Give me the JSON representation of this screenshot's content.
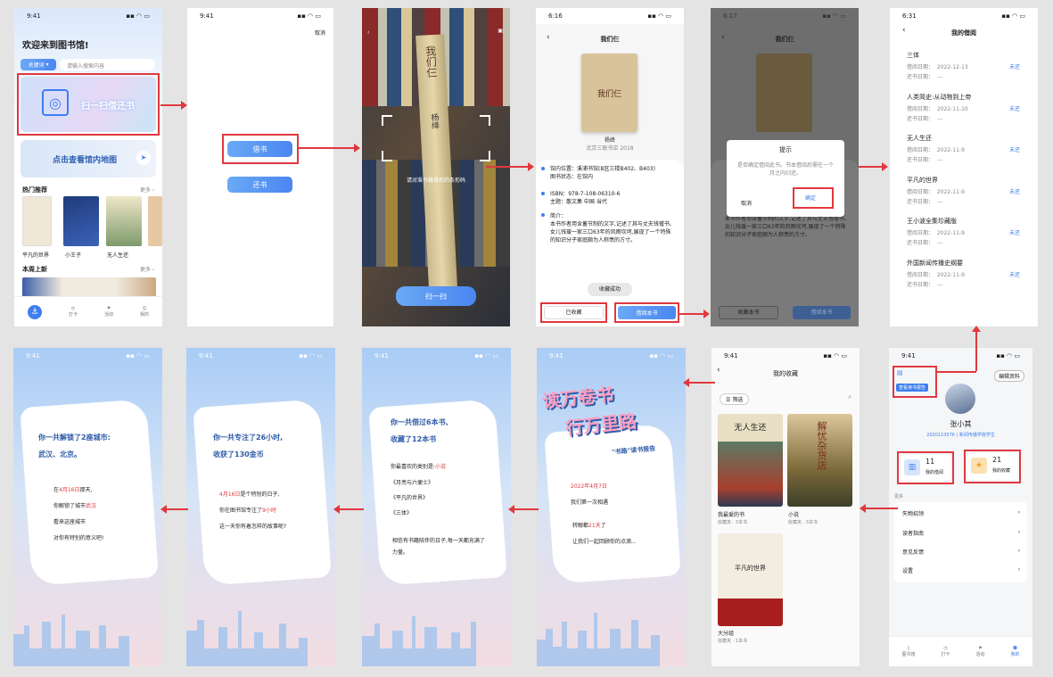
{
  "status_time": "9:41",
  "s1": {
    "welcome": "欢迎来到图书馆!",
    "keyword_btn": "关键词",
    "search_placeholder": "请输入搜索内容",
    "scan_banner": "扫一扫借还书",
    "map_banner": "点击查看馆内地图",
    "hot": "热门推荐",
    "more": "更多",
    "hot_books": [
      "平凡的世界",
      "小王子",
      "无人生还",
      "解忧杂货店"
    ],
    "new_week": "本周上新",
    "nav": [
      "首页",
      "打卡",
      "活动",
      "我的"
    ]
  },
  "s2": {
    "cancel": "取消",
    "borrow": "借书",
    "return": "还书"
  },
  "s3": {
    "hint": "请对准书籍背后的条形码",
    "scan_btn": "扫一扫",
    "spine1": "我们仨",
    "spine2": "杨绛"
  },
  "s4": {
    "title": "我们仨",
    "cover": "我们仨",
    "author": "杨绛",
    "press": "北京三联书店 2018",
    "loc_label": "馆内位置：",
    "loc": "溪浦书馆(B区三楼B402、B403)",
    "status_label": "图书状态：",
    "status": "在馆内",
    "isbn_label": "ISBN：",
    "isbn": "978-7-108-06310-6",
    "topic_label": "主题：",
    "topic": "散文集 中国 当代",
    "intro_label": "简介：",
    "intro": "本书作者用含蓄节制的文字,记述了其与丈夫钱锺书、女儿钱瑗一家三口63年的风雨坎坷,展现了一个特殊的知识分子家庭颇为人称羡的方寸。",
    "toast": "收藏成功",
    "collected": "已收藏",
    "borrow_btn": "借阅本书",
    "time": "6:16"
  },
  "s5": {
    "title": "我们仨",
    "dialog_title": "提示",
    "dialog_msg": "是否确定借阅此书。书本借阅后需在一个月之内归还。",
    "cancel": "取消",
    "ok": "确定",
    "collect": "收藏本书",
    "borrow": "借阅本书",
    "time": "6:17"
  },
  "s6": {
    "title": "我的借阅",
    "time": "6:31",
    "borrow_label": "借阅日期：",
    "return_label": "还书日期：",
    "none": "---",
    "status": "未还",
    "records": [
      {
        "title": "三体",
        "date": "2022-12-13"
      },
      {
        "title": "人类简史:从动物到上帝",
        "date": "2022-11-10"
      },
      {
        "title": "无人生还",
        "date": "2022-11-9"
      },
      {
        "title": "平凡的世界",
        "date": "2022-11-9"
      },
      {
        "title": "王小波全集珍藏版",
        "date": "2022-11-9"
      },
      {
        "title": "外国新闻传播史纲要",
        "date": "2022-11-9"
      }
    ]
  },
  "s7": {
    "edit": "编辑资料",
    "report": "查看读书报告",
    "name": "张小其",
    "sub": "2020123576 | 新闻传播学院学生",
    "borrow_n": "11",
    "borrow_l": "我的借阅",
    "fav_n": "21",
    "fav_l": "我的收藏",
    "more": "更多",
    "menu": [
      "失物招领",
      "读者指南",
      "意见反馈",
      "设置"
    ],
    "nav": [
      "图书馆",
      "打卡",
      "活动",
      "我的"
    ]
  },
  "s8": {
    "title": "我的收藏",
    "filter": "筛选",
    "items": [
      {
        "name": "我最爱的书",
        "count": "收藏夹 · 3本书",
        "cover": "无人生还"
      },
      {
        "name": "小说",
        "count": "收藏夹 · 3本书",
        "cover": "解忧杂货店"
      },
      {
        "name": "大分组",
        "count": "收藏夹 · 1本书",
        "cover": "平凡的世界"
      }
    ]
  },
  "s9": {
    "big1": "读万卷书",
    "big2": "行万里路",
    "sub": "\"书路\"读书报告",
    "date": "2022年4月7日",
    "l1": "我们第一次相遇",
    "l2a": "转眼都",
    "l2b": "21天",
    "l2c": "了",
    "l3": "让我们一起回顾你的点滴..."
  },
  "s10": {
    "h1": "你一共借过6本书、",
    "h2": "收藏了12本书",
    "l1a": "你最喜欢的类别是:",
    "l1b": "小说",
    "books": [
      "《月亮与六便士》",
      "《平凡的世界》",
      "《三体》"
    ],
    "l2": "相信有书籍陪伴的日子,每一天都充满了力量。"
  },
  "s11": {
    "h1": "你一共专注了26小时,",
    "h2": "收获了130金币",
    "d": "4月16日",
    "l1": "是个特别的日子,",
    "l2a": "你在图书馆专注了",
    "l2b": "9小时",
    "l3": "这一天你有着怎样的故事呢?"
  },
  "s12": {
    "h1": "你一共解锁了2座城市:",
    "h2": "武汉、北京。",
    "l1a": "在",
    "l1b": "4月16日",
    "l1c": "那天,",
    "l2a": "你解锁了城市",
    "l2b": "武汉",
    "l3": "看来这座城市",
    "l4": "对你有特别的意义吧!"
  },
  "colors": {
    "accent": "#3d7ff0",
    "highlight": "#e0383e"
  }
}
